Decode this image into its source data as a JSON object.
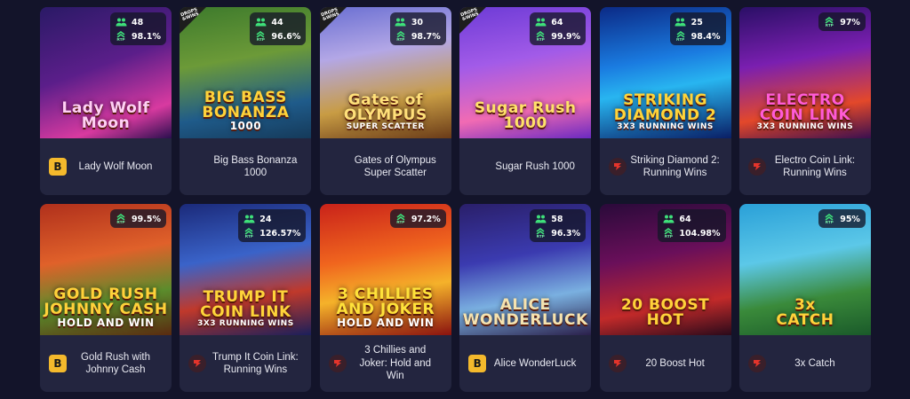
{
  "games": [
    {
      "title": "Lady Wolf Moon",
      "players": "48",
      "rtp": "98.1%",
      "provider": "b",
      "badge": false,
      "art": "Lady Wolf\nMoon",
      "bg": "linear-gradient(160deg,#2a1a66 0%,#5b1e8a 45%,#d83aa0 80%,#2b0f4f 100%)",
      "art_color": "#ffd0f5"
    },
    {
      "title": "Big Bass Bonanza 1000",
      "players": "44",
      "rtp": "96.6%",
      "provider": "none",
      "badge": true,
      "art": "BIG BASS\nBONANZA\n1000",
      "bg": "linear-gradient(170deg,#3d7a2c 0%,#6c9a38 40%,#1f5b8a 75%,#153a5a 100%)",
      "art_color": "#ffd23a"
    },
    {
      "title": "Gates of Olympus Super Scatter",
      "players": "30",
      "rtp": "98.7%",
      "provider": "none",
      "badge": true,
      "art": "Gates of\nOLYMPUS\nSUPER SCATTER",
      "bg": "linear-gradient(170deg,#6a6fd2 0%,#b3a7e6 35%,#c89c44 70%,#6a3b18 100%)",
      "art_color": "#ffe07a"
    },
    {
      "title": "Sugar Rush 1000",
      "players": "64",
      "rtp": "99.9%",
      "provider": "none",
      "badge": true,
      "art": "Sugar Rush\n1000",
      "bg": "linear-gradient(170deg,#6d3bd6 0%,#a25be8 40%,#f16bb3 75%,#6b2ac1 100%)",
      "art_color": "#ffe16a"
    },
    {
      "title": "Striking Diamond 2: Running Wins",
      "players": "25",
      "rtp": "98.4%",
      "provider": "r",
      "badge": false,
      "art": "STRIKING\nDIAMOND 2\n3X3 RUNNING WINS",
      "bg": "linear-gradient(170deg,#0b2a86 0%,#1a7be0 40%,#28b5f0 60%,#0a1f66 100%)",
      "art_color": "#ffd43a"
    },
    {
      "title": "Electro Coin Link: Running Wins",
      "players": "",
      "rtp": "97%",
      "provider": "r",
      "badge": false,
      "art": "ELECTRO\nCOIN LINK\n3X3 RUNNING WINS",
      "bg": "linear-gradient(170deg,#2a0f66 0%,#7a1fb0 40%,#e3482a 75%,#3a0f4f 100%)",
      "art_color": "#ff5bd6"
    },
    {
      "title": "Gold Rush with Johnny Cash",
      "players": "",
      "rtp": "99.5%",
      "provider": "b",
      "badge": false,
      "art": "GOLD RUSH\nJOHNNY CASH\nHOLD AND WIN",
      "bg": "linear-gradient(170deg,#b0301c 0%,#e0612a 40%,#5b8c2c 70%,#5a2a10 100%)",
      "art_color": "#ffd23a"
    },
    {
      "title": "Trump It Coin Link: Running Wins",
      "players": "24",
      "rtp": "126.57%",
      "provider": "r",
      "badge": false,
      "art": "TRUMP IT\nCOIN LINK\n3X3 RUNNING WINS",
      "bg": "linear-gradient(170deg,#1b2a7a 0%,#3a63c9 40%,#c0392b 70%,#1a1f5a 100%)",
      "art_color": "#ffd43a"
    },
    {
      "title": "3 Chillies and Joker: Hold and Win",
      "players": "",
      "rtp": "97.2%",
      "provider": "r",
      "badge": false,
      "art": "3 CHILLIES\nAND JOKER\nHOLD AND WIN",
      "bg": "linear-gradient(170deg,#c9221a 0%,#f0651e 40%,#f5b22a 65%,#8a120f 100%)",
      "art_color": "#ffe23a"
    },
    {
      "title": "Alice WonderLuck",
      "players": "58",
      "rtp": "96.3%",
      "provider": "b",
      "badge": false,
      "art": "ALICE\nWONDERLUCK",
      "bg": "linear-gradient(170deg,#2a1f6a 0%,#3b3bb0 40%,#7ab0e0 70%,#2a1f4a 100%)",
      "art_color": "#f5e3b0"
    },
    {
      "title": "20 Boost Hot",
      "players": "64",
      "rtp": "104.98%",
      "provider": "r",
      "badge": false,
      "art": "20 BOOST\nHOT",
      "bg": "linear-gradient(170deg,#2a0a3a 0%,#6a0f5a 40%,#c22a2a 75%,#2a0a1a 100%)",
      "art_color": "#ffd23a"
    },
    {
      "title": "3x Catch",
      "players": "",
      "rtp": "95%",
      "provider": "r",
      "badge": false,
      "art": "3x\nCATCH",
      "bg": "linear-gradient(170deg,#2aa0d8 0%,#5cc8e8 40%,#3a8a3a 70%,#1a5a2a 100%)",
      "art_color": "#ffd23a"
    }
  ]
}
